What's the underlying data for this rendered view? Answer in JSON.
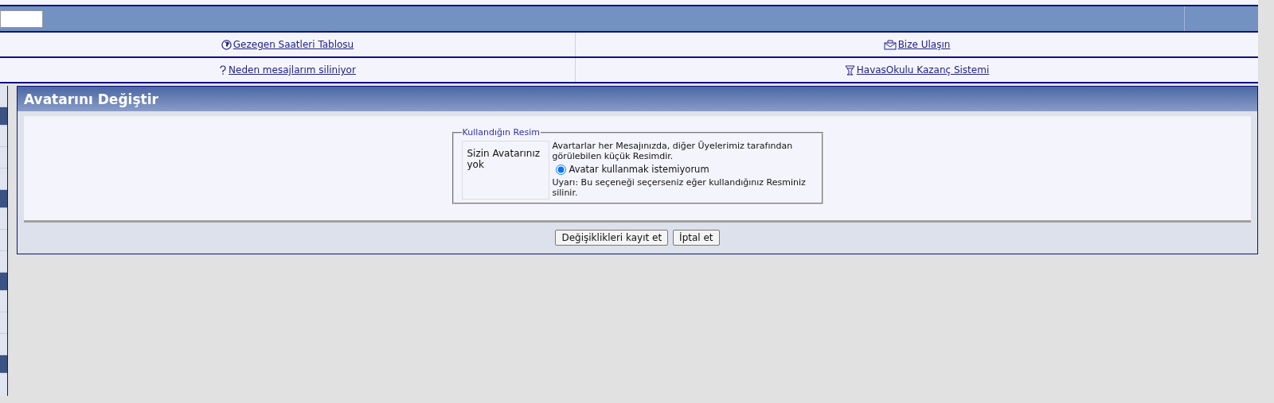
{
  "links": [
    {
      "label": "Gezegen Saatleri Tablosu",
      "kind": "globe"
    },
    {
      "label": "Bize Ulaşın",
      "kind": "mail"
    },
    {
      "label": "Neden mesajlarım siliniyor",
      "kind": "question"
    },
    {
      "label": "HavasOkulu Kazanç Sistemi",
      "kind": "cup"
    }
  ],
  "panel": {
    "title": "Avatarını Değiştir",
    "fieldset": {
      "legend": "Kullandığın Resim",
      "avatar_text": "Sizin Avatarınız yok",
      "description": "Avartarlar her Mesajınızda, diğer Üyelerimiz tarafından görülebilen küçük Resimdir.",
      "option": {
        "label": "Avatar kullanmak istemiyorum",
        "selected": true
      },
      "warning": "Uyarı: Bu seçeneği seçerseniz eğer kullandığınız Resminiz silinir."
    },
    "buttons": [
      "Değişiklikleri kayıt et",
      "İptal et"
    ]
  }
}
